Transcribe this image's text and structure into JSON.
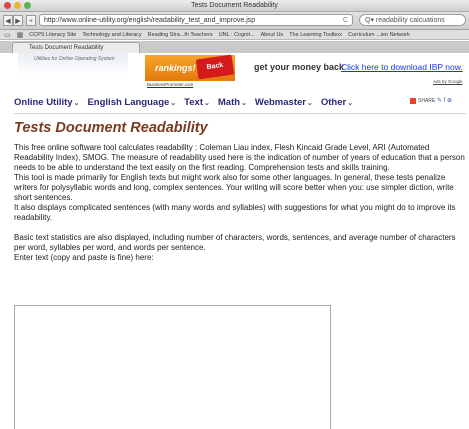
{
  "window": {
    "title": "Tests Document Readability"
  },
  "toolbar": {
    "back_label": "◀",
    "forward_label": "▶",
    "add_label": "+",
    "url": "http://www.online-utility.org/english/readability_test_and_improve.jsp",
    "reload_label": "C",
    "search_value": "Q▾ readability calcuations"
  },
  "bookmarks": {
    "items": [
      "CCPS Literacy Site",
      "Technology and Literacy",
      "Reading Stra...th Teachers",
      "UNL : Cognit...",
      "About Us",
      "The Learning Toolbox",
      "Curriculum ...ien Network"
    ]
  },
  "tab": {
    "label": "Tests Document Readability"
  },
  "banner": {
    "logo_tagline": "Utilities for Online Operating System",
    "ad_word": "rankings!",
    "ad_badge": "Back",
    "ad_url": "BusinessPromoter.com",
    "ad_text": "get your money back",
    "ad_link": "Click here to download IBP now.",
    "ads_by": "Ads by Google"
  },
  "menu": {
    "items": [
      "Online Utility",
      "English Language",
      "Text",
      "Math",
      "Webmaster",
      "Other"
    ],
    "share_label": "SHARE"
  },
  "page": {
    "title": "Tests Document Readability",
    "para1": "This free online software tool calculates readability : Coleman Liau index, Flesh Kincaid Grade Level, ARI (Automated Readability Index), SMOG. The measure of readability used here is the indication of number of years of education that a person needs to be able to understand the text easily on the first reading. Comprehension tests and skills training.",
    "para2": "This tool is made primarily for English texts but might work also for some other languages. In general, these tests penalize writers for polysyllabic words and long, complex sentences. Your writing will score better when you: use simpler diction, write short sentences.",
    "para3": "It also displays complicated sentences (with many words and syllables) with suggestions for what you might do to improve its readability.",
    "para4": "Basic text statistics are also displayed, including number of characters, words, sentences, and average number of characters per word, syllables per word, and words per sentence.",
    "input_label": "Enter text (copy and paste is fine) here:",
    "textarea_value": ""
  }
}
